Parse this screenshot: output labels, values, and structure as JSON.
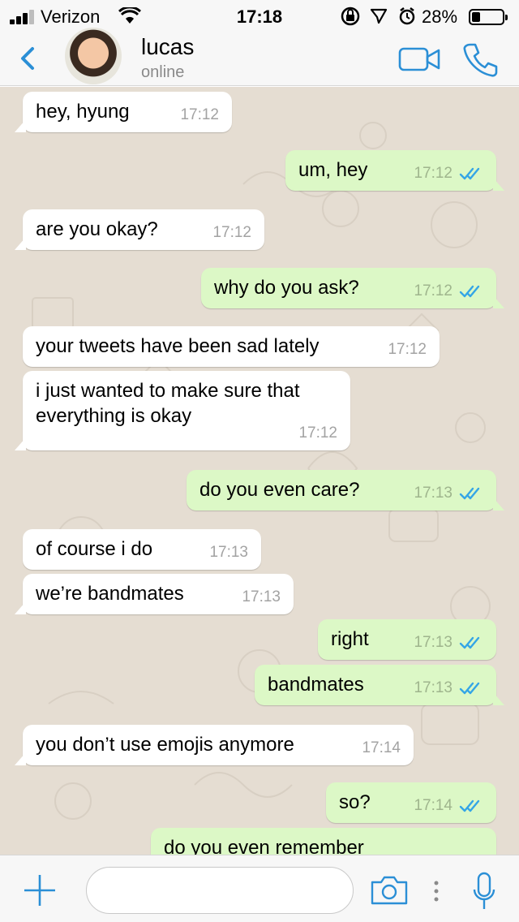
{
  "status_bar": {
    "carrier": "Verizon",
    "time": "17:18",
    "battery": "28%",
    "battery_level": 0.28
  },
  "header": {
    "back_icon": "chevron-left-icon",
    "contact_name": "lucas",
    "contact_status": "online",
    "video_icon": "video-camera-icon",
    "call_icon": "phone-icon"
  },
  "messages": [
    {
      "dir": "in",
      "text": "hey, hyung",
      "time": "17:12"
    },
    {
      "dir": "out",
      "text": "um, hey",
      "time": "17:12",
      "read": true
    },
    {
      "dir": "in",
      "text": "are you okay?",
      "time": "17:12"
    },
    {
      "dir": "out",
      "text": "why do you ask?",
      "time": "17:12",
      "read": true
    },
    {
      "dir": "in",
      "text": "your tweets have been sad lately",
      "time": "17:12"
    },
    {
      "dir": "in",
      "text": "i just wanted to make sure that everything is okay",
      "time": "17:12"
    },
    {
      "dir": "out",
      "text": "do you even care?",
      "time": "17:13",
      "read": true
    },
    {
      "dir": "in",
      "text": "of course i do",
      "time": "17:13"
    },
    {
      "dir": "in",
      "text": "we’re bandmates",
      "time": "17:13"
    },
    {
      "dir": "out",
      "text": "right",
      "time": "17:13",
      "read": true
    },
    {
      "dir": "out",
      "text": "bandmates",
      "time": "17:13",
      "read": true
    },
    {
      "dir": "in",
      "text": "you don’t use emojis anymore",
      "time": "17:14"
    },
    {
      "dir": "out",
      "text": "so?",
      "time": "17:14",
      "read": true
    },
    {
      "dir": "out",
      "text": "do you even remember me using",
      "time": ""
    }
  ],
  "input_bar": {
    "plus_icon": "plus-icon",
    "placeholder": "",
    "camera_icon": "camera-icon",
    "more_icon": "more-vertical-icon",
    "mic_icon": "microphone-icon"
  },
  "colors": {
    "accent": "#2b8fd6",
    "chat_background": "#e5ddd2",
    "incoming_bubble": "#ffffff",
    "outgoing_bubble": "#dcf8c6",
    "read_ticks": "#34a5e6"
  }
}
